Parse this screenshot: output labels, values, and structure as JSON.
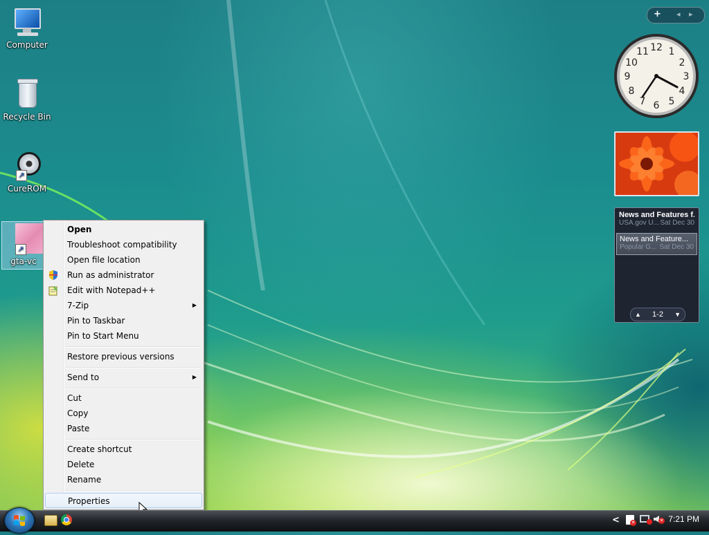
{
  "desktop": {
    "icons": [
      {
        "label": "Computer"
      },
      {
        "label": "Recycle Bin"
      },
      {
        "label": "CureROM"
      },
      {
        "label": "gta-vc"
      }
    ]
  },
  "context_menu": {
    "items": [
      {
        "label": "Open"
      },
      {
        "label": "Troubleshoot compatibility"
      },
      {
        "label": "Open file location"
      },
      {
        "label": "Run as administrator"
      },
      {
        "label": "Edit with Notepad++"
      },
      {
        "label": "7-Zip"
      },
      {
        "label": "Pin to Taskbar"
      },
      {
        "label": "Pin to Start Menu"
      },
      {
        "label": "Restore previous versions"
      },
      {
        "label": "Send to"
      },
      {
        "label": "Cut"
      },
      {
        "label": "Copy"
      },
      {
        "label": "Paste"
      },
      {
        "label": "Create shortcut"
      },
      {
        "label": "Delete"
      },
      {
        "label": "Rename"
      },
      {
        "label": "Properties"
      }
    ]
  },
  "sidebar": {
    "controls": {
      "add": "+",
      "prev": "◂",
      "next": "▸"
    },
    "clock": {
      "time": "4:21"
    },
    "feeds": {
      "items": [
        {
          "title": "News and Features f...",
          "source": "USA.gov U...",
          "date": "Sat Dec 30"
        },
        {
          "title": "News and Feature...",
          "source": "Popular G...",
          "date": "Sat Dec 30"
        }
      ],
      "nav": {
        "up": "▲",
        "page": "1-2",
        "down": "▼"
      }
    }
  },
  "taskbar": {
    "time": "7:21 PM",
    "tray_arrow": "<"
  },
  "colors": {
    "menu_bg": "#f0f0f0",
    "highlight_border": "#aeccf0",
    "taskbar": "#23262a"
  }
}
